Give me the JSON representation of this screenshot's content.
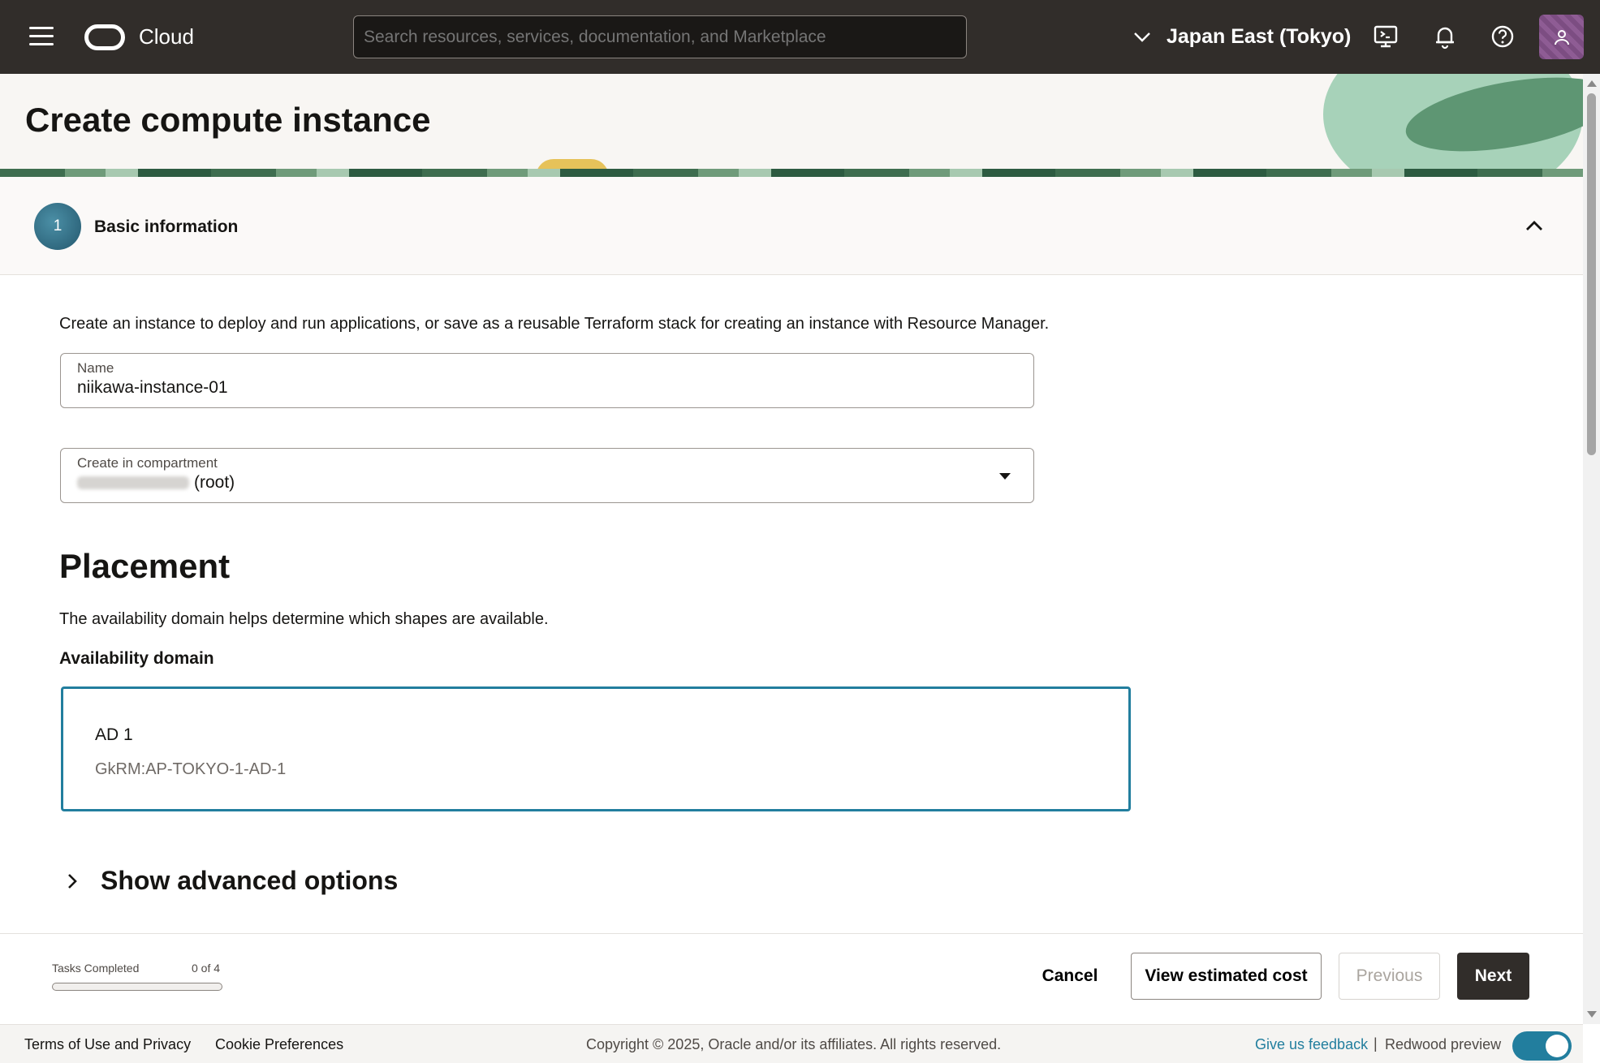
{
  "topbar": {
    "brand": "Cloud",
    "search_placeholder": "Search resources, services, documentation, and Marketplace",
    "region": "Japan East (Tokyo)",
    "icons": [
      "menu-icon",
      "cloud-logo-icon",
      "chevron-down-icon",
      "cloud-shell-icon",
      "bell-icon",
      "help-icon",
      "user-icon"
    ]
  },
  "header": {
    "title": "Create compute instance"
  },
  "step": {
    "number": "1",
    "title": "Basic information"
  },
  "form": {
    "intro": "Create an instance to deploy and run applications, or save as a reusable Terraform stack for creating an instance with Resource Manager.",
    "name_label": "Name",
    "name_value": "niikawa-instance-01",
    "compartment_label": "Create in compartment",
    "compartment_suffix": "(root)"
  },
  "placement": {
    "title": "Placement",
    "description": "The availability domain helps determine which shapes are available.",
    "ad_label": "Availability domain",
    "ad_name": "AD 1",
    "ad_id": "GkRM:AP-TOKYO-1-AD-1",
    "advanced_label": "Show advanced options"
  },
  "actions": {
    "tasks_label": "Tasks Completed",
    "tasks_count": "0 of 4",
    "tasks_progress": 0,
    "cancel": "Cancel",
    "view_cost": "View estimated cost",
    "previous": "Previous",
    "next": "Next"
  },
  "footer": {
    "terms": "Terms of Use and Privacy",
    "cookies": "Cookie Preferences",
    "copyright": "Copyright © 2025, Oracle and/or its affiliates. All rights reserved.",
    "feedback": "Give us feedback",
    "separator": "|",
    "redwood": "Redwood preview"
  },
  "colors": {
    "accent": "#227e9e",
    "topbar": "#312d2a"
  }
}
